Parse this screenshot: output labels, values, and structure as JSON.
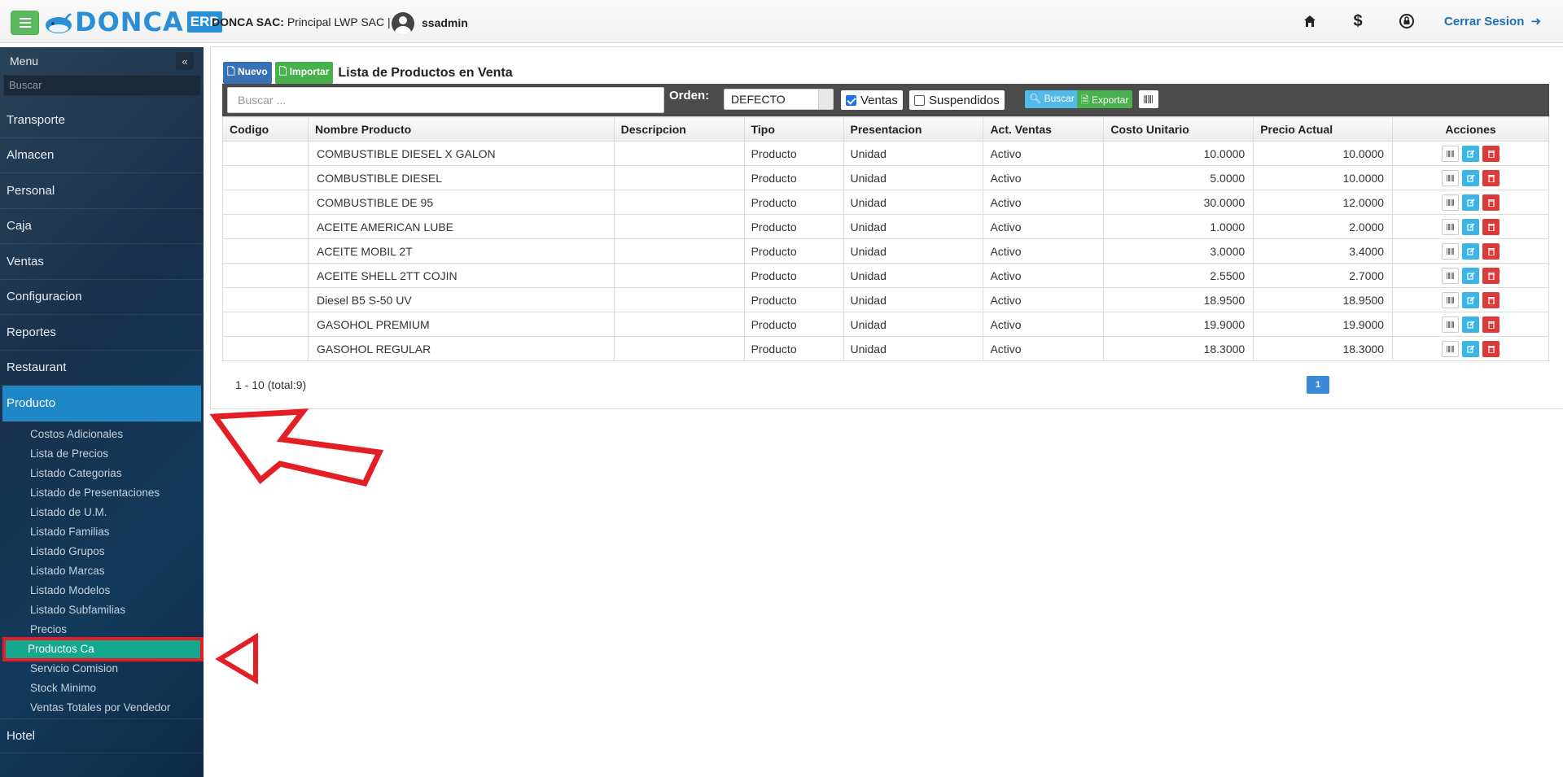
{
  "header": {
    "menu_icon": "hamburger-icon",
    "logo_text": "DONCA",
    "logo_badge": "ERP",
    "company_name": "DONCA SAC:",
    "company_branch": "Principal LWP SAC |",
    "username": "ssadmin",
    "icons": [
      "home-icon",
      "dollar-icon",
      "lock-reset-icon"
    ],
    "logout_label": "Cerrar Sesion"
  },
  "sidebar": {
    "title": "Menu",
    "search_placeholder": "Buscar",
    "items": [
      {
        "label": "Transporte"
      },
      {
        "label": "Almacen"
      },
      {
        "label": "Personal"
      },
      {
        "label": "Caja"
      },
      {
        "label": "Ventas"
      },
      {
        "label": "Configuracion"
      },
      {
        "label": "Reportes"
      },
      {
        "label": "Restaurant"
      },
      {
        "label": "Producto"
      }
    ],
    "subitems": [
      {
        "label": "Costos Adicionales"
      },
      {
        "label": "Lista de Precios"
      },
      {
        "label": "Listado Categorias"
      },
      {
        "label": "Listado de Presentaciones"
      },
      {
        "label": "Listado de U.M."
      },
      {
        "label": "Listado Familias"
      },
      {
        "label": "Listado Grupos"
      },
      {
        "label": "Listado Marcas"
      },
      {
        "label": "Listado Modelos"
      },
      {
        "label": "Listado Subfamilias"
      },
      {
        "label": "Precios"
      },
      {
        "label": "Productos Ca"
      },
      {
        "label": "Servicio Comision"
      },
      {
        "label": "Stock Minimo"
      },
      {
        "label": "Ventas Totales por Vendedor"
      }
    ],
    "last_item": "Hotel"
  },
  "main": {
    "btn_nuevo": "Nuevo",
    "btn_importar": "Importar",
    "title": "Lista de Productos en Venta",
    "search_placeholder": "Buscar ...",
    "orden_label": "Orden:",
    "orden_value": "DEFECTO",
    "check_ventas": "Ventas",
    "check_suspendidos": "Suspendidos",
    "btn_buscar": "Buscar",
    "btn_exportar": "Exportar",
    "columns": [
      "Codigo",
      "Nombre Producto",
      "Descripcion",
      "Tipo",
      "Presentacion",
      "Act. Ventas",
      "Costo Unitario",
      "Precio Actual",
      "Acciones"
    ],
    "rows": [
      [
        "",
        "COMBUSTIBLE DIESEL X GALON",
        "",
        "Producto",
        "Unidad",
        "Activo",
        "10.0000",
        "10.0000"
      ],
      [
        "",
        "COMBUSTIBLE DIESEL",
        "",
        "Producto",
        "Unidad",
        "Activo",
        "5.0000",
        "10.0000"
      ],
      [
        "",
        "COMBUSTIBLE DE 95",
        "",
        "Producto",
        "Unidad",
        "Activo",
        "30.0000",
        "12.0000"
      ],
      [
        "",
        "ACEITE AMERICAN LUBE",
        "",
        "Producto",
        "Unidad",
        "Activo",
        "1.0000",
        "2.0000"
      ],
      [
        "",
        "ACEITE MOBIL 2T",
        "",
        "Producto",
        "Unidad",
        "Activo",
        "3.0000",
        "3.4000"
      ],
      [
        "",
        "ACEITE SHELL 2TT COJIN",
        "",
        "Producto",
        "Unidad",
        "Activo",
        "2.5500",
        "2.7000"
      ],
      [
        "",
        "Diesel B5 S-50 UV",
        "",
        "Producto",
        "Unidad",
        "Activo",
        "18.9500",
        "18.9500"
      ],
      [
        "",
        "GASOHOL PREMIUM",
        "",
        "Producto",
        "Unidad",
        "Activo",
        "19.9000",
        "19.9000"
      ],
      [
        "",
        "GASOHOL REGULAR",
        "",
        "Producto",
        "Unidad",
        "Activo",
        "18.3000",
        "18.3000"
      ]
    ],
    "pager_info": "1 - 10 (total:9)",
    "current_page": "1"
  },
  "colors": {
    "sidebar_active": "#1f86c8",
    "sidebar_selected": "#14a88e",
    "annotation_red": "#e31e24"
  }
}
